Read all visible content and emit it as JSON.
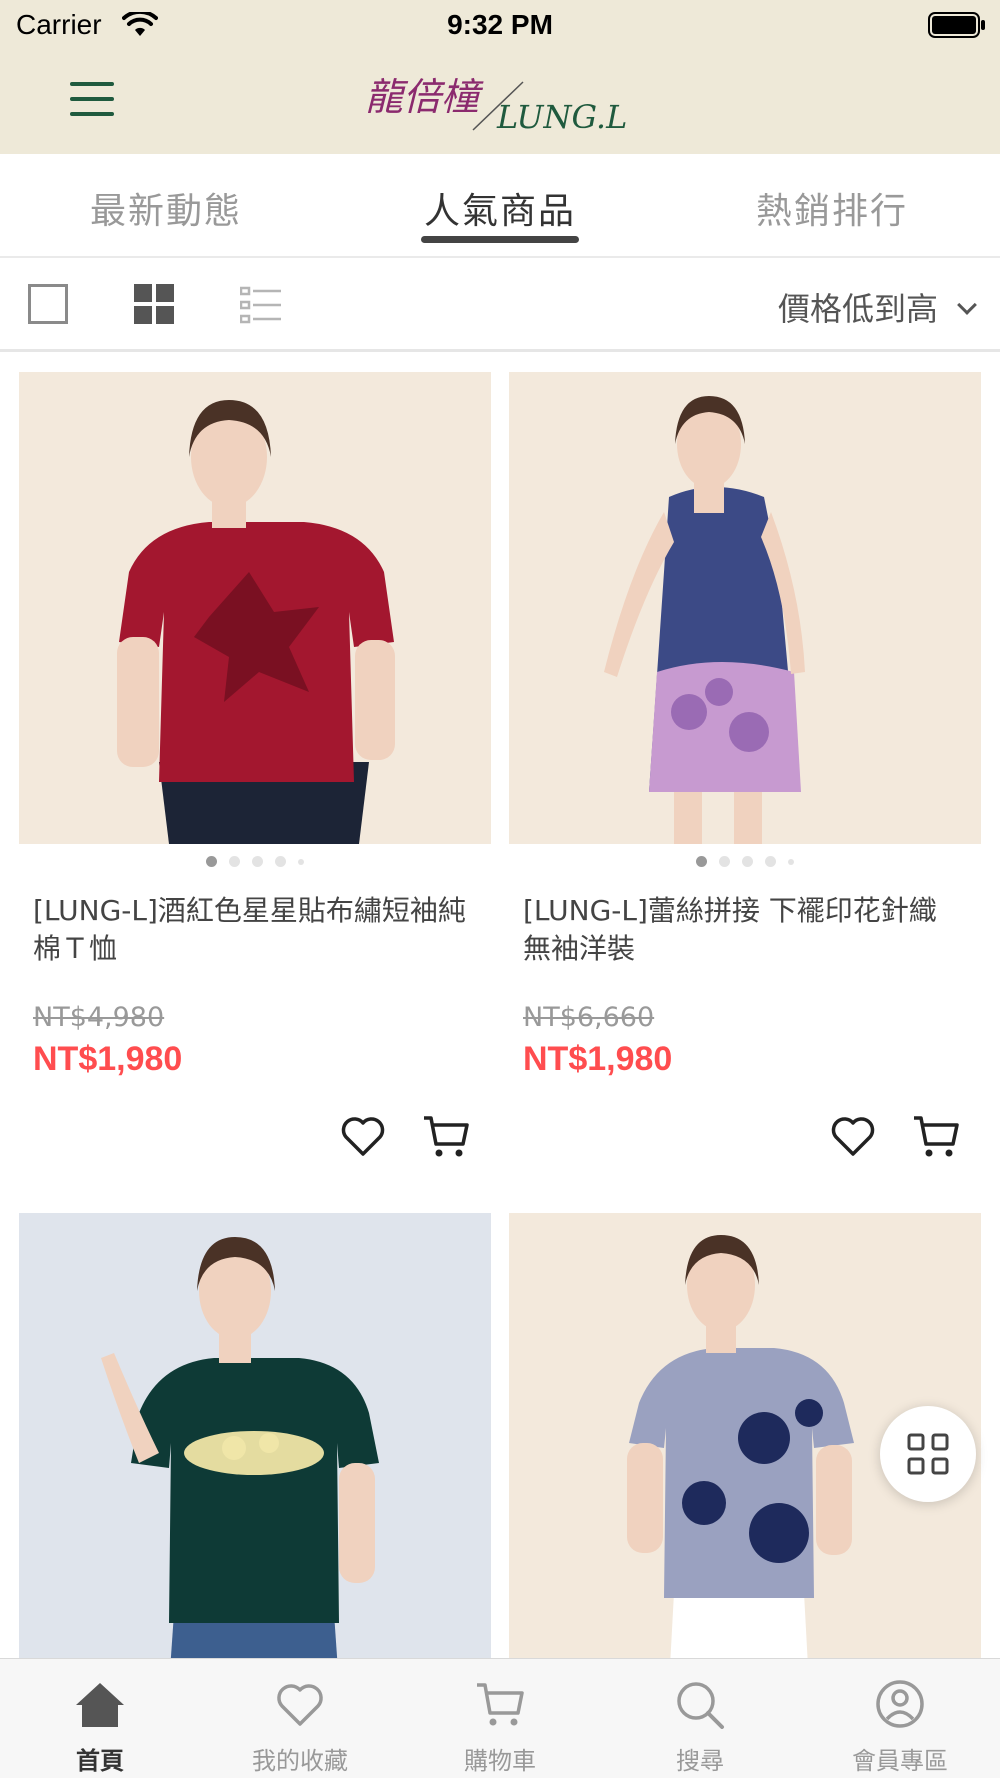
{
  "status_bar": {
    "carrier": "Carrier",
    "time": "9:32 PM"
  },
  "header": {
    "logo_text": "LUNG.L",
    "logo_script": "龍倍橦"
  },
  "tabs": [
    {
      "label": "最新動態",
      "active": false
    },
    {
      "label": "人氣商品",
      "active": true
    },
    {
      "label": "熱銷排行",
      "active": false
    }
  ],
  "toolbar": {
    "sort_label": "價格低到高"
  },
  "products": [
    {
      "title": "[LUNG-L]酒紅色星星貼布繡短袖純棉Ｔ恤",
      "old_price": "NT$4,980",
      "price": "NT$1,980",
      "image_colors": {
        "bg": "#f3e9dc",
        "garment": "#a3172f"
      }
    },
    {
      "title": "[LUNG-L]蕾絲拼接 下襬印花針織無袖洋裝",
      "old_price": "NT$6,660",
      "price": "NT$1,980",
      "image_colors": {
        "bg": "#f3e9dc",
        "garment": "#3c4a86"
      }
    },
    {
      "title": "",
      "old_price": "",
      "price": "",
      "image_colors": {
        "bg": "#dfe4ec",
        "garment": "#0e3a36"
      }
    },
    {
      "title": "",
      "old_price": "",
      "price": "",
      "image_colors": {
        "bg": "#f3e9dc",
        "garment": "#9aa1c0"
      }
    }
  ],
  "bottom_nav": [
    {
      "label": "首頁",
      "icon": "home-icon",
      "active": true
    },
    {
      "label": "我的收藏",
      "icon": "heart-icon",
      "active": false
    },
    {
      "label": "購物車",
      "icon": "cart-icon",
      "active": false
    },
    {
      "label": "搜尋",
      "icon": "search-icon",
      "active": false
    },
    {
      "label": "會員專區",
      "icon": "user-icon",
      "active": false
    }
  ],
  "colors": {
    "header_bg": "#eee9d8",
    "price_red": "#ff4d4f",
    "menu_green": "#1f5a3e"
  }
}
